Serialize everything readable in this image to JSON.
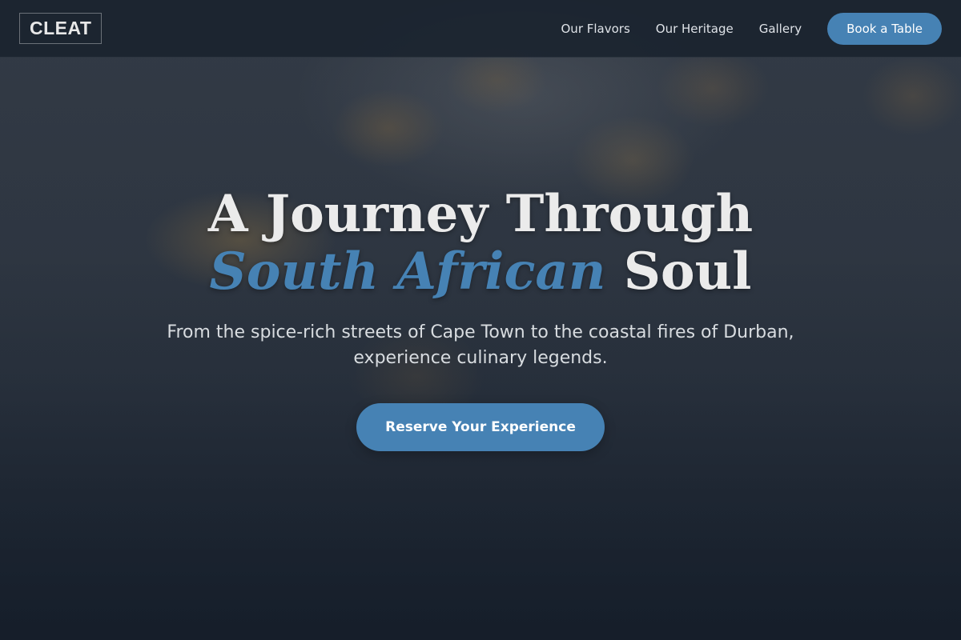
{
  "header": {
    "logo": "CLEAT",
    "nav": [
      {
        "label": "Our Flavors"
      },
      {
        "label": "Our Heritage"
      },
      {
        "label": "Gallery"
      }
    ],
    "cta_label": "Book a Table"
  },
  "hero": {
    "headline_part1": "A Journey Through ",
    "headline_accent": "South African",
    "headline_part2": " Soul",
    "subtitle": "From the spice-rich streets of Cape Town to the coastal fires of Durban, experience culinary legends.",
    "cta_label": "Reserve Your Experience"
  },
  "colors": {
    "accent": "#4682b4",
    "header_bg": "#19222e",
    "headline_text": "#ebebeb"
  }
}
